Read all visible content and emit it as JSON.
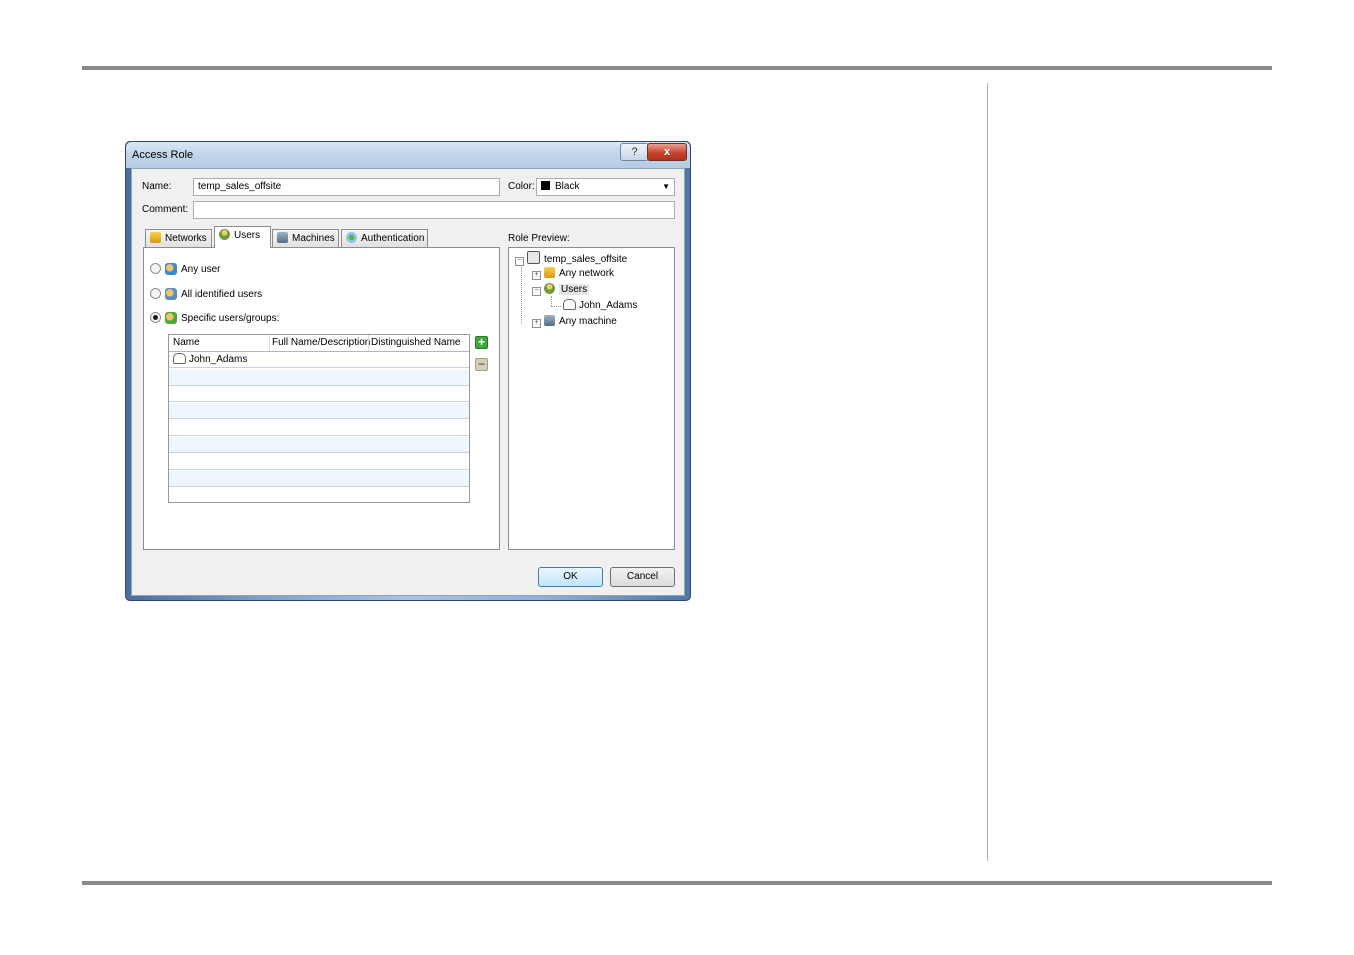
{
  "window": {
    "title": "Access Role",
    "help_label": "?",
    "close_label": "x"
  },
  "form": {
    "name_label": "Name:",
    "name_value": "temp_sales_offsite",
    "color_label": "Color:",
    "color_value": "Black",
    "comment_label": "Comment:",
    "comment_value": ""
  },
  "tabs": [
    {
      "label": "Networks",
      "icon": "network-icon"
    },
    {
      "label": "Users",
      "icon": "users-icon",
      "active": true
    },
    {
      "label": "Machines",
      "icon": "machine-icon"
    },
    {
      "label": "Authentication",
      "icon": "authentication-icon"
    }
  ],
  "users_tab": {
    "options": [
      {
        "label": "Any user",
        "selected": false
      },
      {
        "label": "All identified users",
        "selected": false
      },
      {
        "label": "Specific users/groups:",
        "selected": true
      }
    ],
    "table": {
      "columns": [
        "Name",
        "Full Name/Description",
        "Distinguished Name"
      ],
      "rows": [
        {
          "name": "John_Adams",
          "full_name": "",
          "dn": ""
        }
      ]
    }
  },
  "preview": {
    "label": "Role Preview:",
    "root": "temp_sales_offsite",
    "nodes": [
      "Any network",
      "Users",
      "John_Adams",
      "Any machine"
    ]
  },
  "buttons": {
    "ok": "OK",
    "cancel": "Cancel"
  }
}
